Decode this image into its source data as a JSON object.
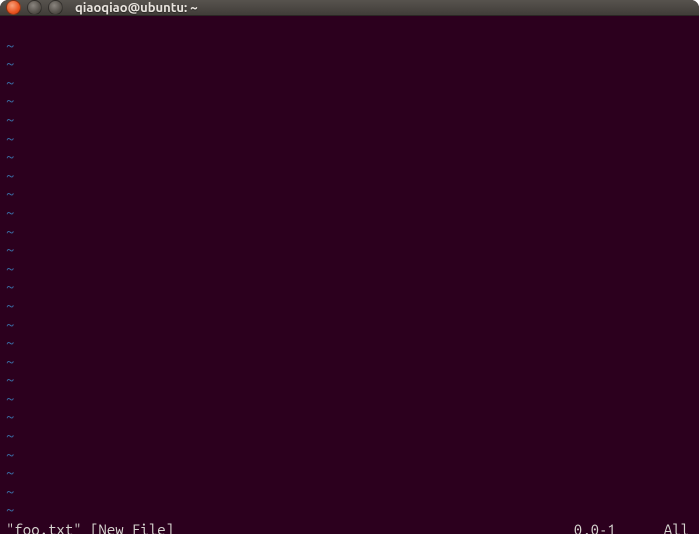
{
  "titlebar": {
    "title": "qiaoqiao@ubuntu: ~",
    "buttons": {
      "close": "close",
      "min": "minimize",
      "max": "maximize"
    }
  },
  "editor": {
    "empty_line_marker": "~",
    "empty_line_count": 26,
    "status": {
      "filename": "\"foo.txt\"",
      "flag": "[New File]",
      "position": "0,0-1",
      "percent": "All"
    }
  },
  "colors": {
    "background": "#2c001e",
    "tilde": "#3a6ea5",
    "text": "#d6d4cf",
    "accent_close": "#e95420"
  }
}
